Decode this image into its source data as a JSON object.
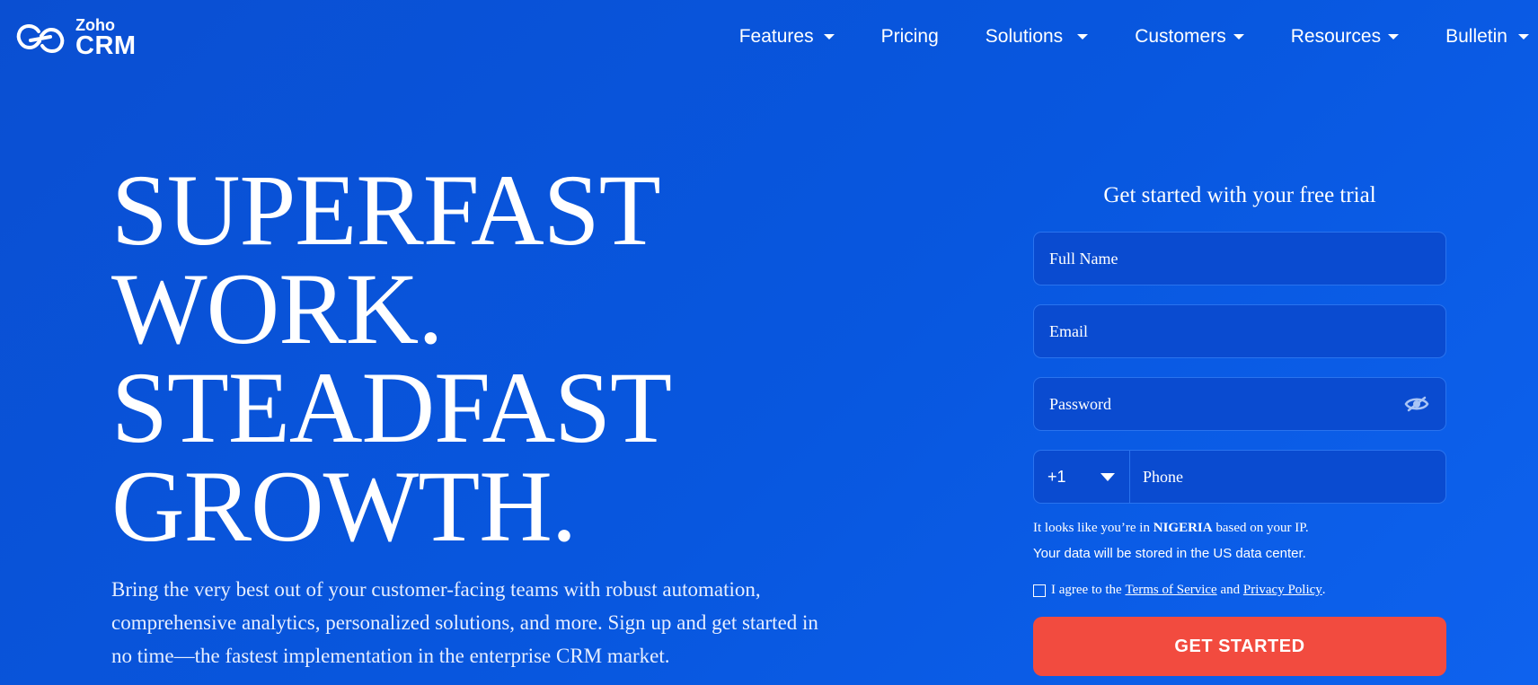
{
  "header": {
    "logo": {
      "brand_top": "Zoho",
      "brand_bottom": "CRM",
      "icon": "zoho-infinity-logo"
    },
    "nav": [
      {
        "label": "Features",
        "has_dropdown": true
      },
      {
        "label": "Pricing",
        "has_dropdown": false
      },
      {
        "label": "Solutions",
        "has_dropdown": true
      },
      {
        "label": "Customers",
        "has_dropdown": true
      },
      {
        "label": "Resources",
        "has_dropdown": true
      },
      {
        "label": "Bulletin",
        "has_dropdown": true
      }
    ]
  },
  "hero": {
    "title_lines": [
      "SUPERFAST",
      "WORK.",
      "STEADFAST",
      "GROWTH."
    ],
    "subtitle": "Bring the very best out of your customer-facing teams with robust automation, comprehensive analytics, personalized solutions, and more. Sign up and get started in no time—the fastest implementation in the enterprise CRM market."
  },
  "signup_form": {
    "title": "Get started with your free trial",
    "full_name": {
      "value": "",
      "placeholder": "Full Name"
    },
    "email": {
      "value": "",
      "placeholder": "Email"
    },
    "password": {
      "value": "",
      "placeholder": "Password",
      "toggle_icon": "eye-slash-icon"
    },
    "phone": {
      "country_code": "+1",
      "value": "",
      "placeholder": "Phone"
    },
    "ip_note_prefix": "It looks like you’re in",
    "ip_note_country": "NIGERIA",
    "ip_note_suffix": "based on your IP.",
    "data_center_note": "Your data will be stored in the US data center.",
    "agree_prefix": "I agree to the",
    "terms_label": "Terms of Service",
    "agree_and": "and",
    "privacy_label": "Privacy Policy",
    "agree_suffix": ".",
    "agree_checked": false,
    "submit_label": "GET STARTED"
  },
  "colors": {
    "background": "#0857df",
    "field_bg": "#0a4bd0",
    "field_border": "#2a73ee",
    "cta": "#f24b3f",
    "text": "#ffffff"
  }
}
